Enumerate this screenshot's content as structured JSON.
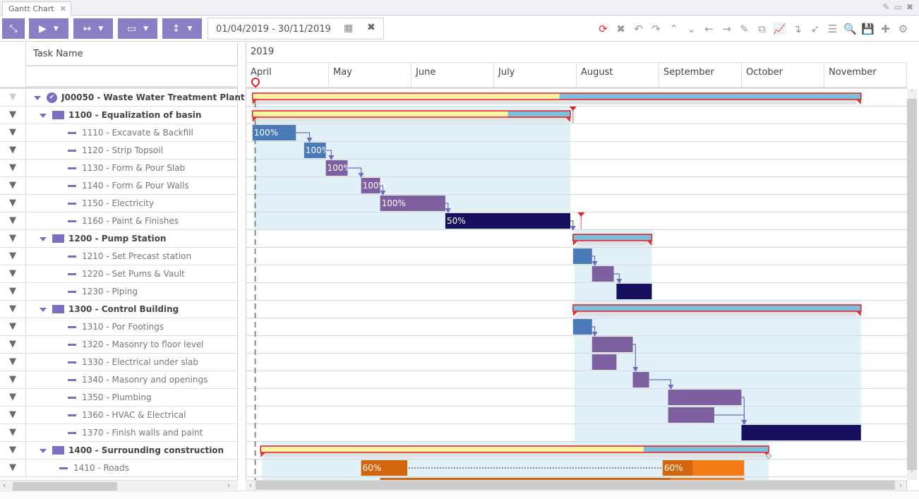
{
  "window": {
    "tab_label": "Gantt Chart",
    "tab_close_icon": "close-icon",
    "window_icons": [
      "edit-icon",
      "maximize-icon",
      "close-icon"
    ]
  },
  "toolbar": {
    "left_buttons": [
      {
        "name": "collapse-button",
        "icon": "compress-icon",
        "glyph": "⤡",
        "dropdown": false
      },
      {
        "name": "play-button",
        "icon": "play-icon",
        "glyph": "▶",
        "dropdown": true
      },
      {
        "name": "fit-width-button",
        "icon": "horizontal-arrows-icon",
        "glyph": "↔",
        "dropdown": true
      },
      {
        "name": "display-button",
        "icon": "monitor-icon",
        "glyph": "🖵",
        "dropdown": true
      },
      {
        "name": "row-height-button",
        "icon": "vertical-arrows-icon",
        "glyph": "↕",
        "dropdown": true
      }
    ],
    "date_range": "01/04/2019 - 30/11/2019",
    "right_icons": [
      {
        "name": "refresh-icon",
        "glyph": "⟳",
        "accent": true
      },
      {
        "name": "cancel-icon",
        "glyph": "✖"
      },
      {
        "name": "undo-icon",
        "glyph": "↶"
      },
      {
        "name": "redo-icon",
        "glyph": "↷"
      },
      {
        "name": "collapse-all-icon",
        "glyph": "⌃"
      },
      {
        "name": "expand-all-icon",
        "glyph": "⌄"
      },
      {
        "name": "arrow-left-icon",
        "glyph": "←"
      },
      {
        "name": "arrow-right-icon",
        "glyph": "→"
      },
      {
        "name": "highlight-icon",
        "glyph": "✎"
      },
      {
        "name": "fit-to-screen-icon",
        "glyph": "⧉"
      },
      {
        "name": "line-chart-icon",
        "glyph": "📈"
      },
      {
        "name": "indent-icon",
        "glyph": "↴"
      },
      {
        "name": "rocket-icon",
        "glyph": "➶"
      },
      {
        "name": "list-icon",
        "glyph": "☰"
      },
      {
        "name": "search-icon",
        "glyph": "🔍"
      },
      {
        "name": "save-icon",
        "glyph": "💾"
      },
      {
        "name": "add-icon",
        "glyph": "✚"
      },
      {
        "name": "settings-icon",
        "glyph": "⚙"
      }
    ]
  },
  "grid": {
    "column_header": "Task Name",
    "rows": [
      {
        "label": "J00050 - Waste Water Treatment Plant",
        "level": 0,
        "type": "project"
      },
      {
        "label": "1100 - Equalization of basin",
        "level": 1,
        "type": "group"
      },
      {
        "label": "1110 - Excavate & Backfill",
        "level": 2,
        "type": "task"
      },
      {
        "label": "1120 - Strip Topsoil",
        "level": 2,
        "type": "task"
      },
      {
        "label": "1130 - Form & Pour Slab",
        "level": 2,
        "type": "task"
      },
      {
        "label": "1140 - Form & Pour Walls",
        "level": 2,
        "type": "task"
      },
      {
        "label": "1150 - Electricity",
        "level": 2,
        "type": "task"
      },
      {
        "label": "1160 - Paint & Finishes",
        "level": 2,
        "type": "task"
      },
      {
        "label": "1200 - Pump Station",
        "level": 1,
        "type": "group"
      },
      {
        "label": "1210 - Set Precast station",
        "level": 2,
        "type": "task"
      },
      {
        "label": "1220 - Set Pums & Vault",
        "level": 2,
        "type": "task"
      },
      {
        "label": "1230 - Piping",
        "level": 2,
        "type": "task"
      },
      {
        "label": "1300 - Control Building",
        "level": 1,
        "type": "group"
      },
      {
        "label": "1310 - Por Footings",
        "level": 2,
        "type": "task"
      },
      {
        "label": "1320 - Masonry to floor level",
        "level": 2,
        "type": "task"
      },
      {
        "label": "1330 - Electrical under slab",
        "level": 2,
        "type": "task"
      },
      {
        "label": "1340 - Masonry and openings",
        "level": 2,
        "type": "task"
      },
      {
        "label": "1350 - Plumbing",
        "level": 2,
        "type": "task"
      },
      {
        "label": "1360 - HVAC & Electrical",
        "level": 2,
        "type": "task"
      },
      {
        "label": "1370 - Finish walls and paint",
        "level": 2,
        "type": "task"
      },
      {
        "label": "1400 - Surrounding construction",
        "level": 1,
        "type": "group"
      },
      {
        "label": "1410 - Roads",
        "level": 1.5,
        "type": "task"
      }
    ]
  },
  "timeline": {
    "year": "2019",
    "months": [
      "April",
      "May",
      "June",
      "July",
      "August",
      "September",
      "October",
      "November"
    ],
    "unit": "days since 2019-04-01",
    "colors": {
      "summary_progress": "#fff3a6",
      "summary_remaining": "#7cbfdc",
      "summary_border": "#e41e1e",
      "task_blue": "#4a7ab8",
      "task_purple": "#7e60a0",
      "task_navy": "#16105f",
      "task_orange": "#d2660f",
      "task_orange_light": "#f37c16",
      "group_bg": "#e2f1f7",
      "link": "#6d6bbf"
    },
    "bars": [
      {
        "row": 0,
        "kind": "summary",
        "start": 2,
        "end": 226,
        "progress_end": 115
      },
      {
        "row": 1,
        "kind": "summary",
        "start": 2,
        "end": 119,
        "progress_end": 96
      },
      {
        "row": 2,
        "kind": "task",
        "start": 2,
        "end": 18,
        "color": "task_blue",
        "label": "100%"
      },
      {
        "row": 3,
        "kind": "task",
        "start": 21,
        "end": 29,
        "color": "task_blue",
        "label": "100%"
      },
      {
        "row": 4,
        "kind": "task",
        "start": 29,
        "end": 37,
        "color": "task_purple",
        "label": "100%"
      },
      {
        "row": 5,
        "kind": "task",
        "start": 42,
        "end": 49,
        "color": "task_purple",
        "label": "100%"
      },
      {
        "row": 6,
        "kind": "task",
        "start": 49,
        "end": 73,
        "color": "task_purple",
        "label": "100%"
      },
      {
        "row": 7,
        "kind": "task",
        "start": 73,
        "end": 119,
        "color": "task_navy",
        "label": "50%"
      },
      {
        "row": 8,
        "kind": "summary",
        "start": 120,
        "end": 149,
        "progress_end": 120
      },
      {
        "row": 9,
        "kind": "task",
        "start": 120,
        "end": 127,
        "color": "task_blue",
        "label": ""
      },
      {
        "row": 10,
        "kind": "task",
        "start": 127,
        "end": 135,
        "color": "task_purple",
        "label": ""
      },
      {
        "row": 11,
        "kind": "task",
        "start": 136,
        "end": 149,
        "color": "task_navy",
        "label": ""
      },
      {
        "row": 12,
        "kind": "summary",
        "start": 120,
        "end": 226,
        "progress_end": 120
      },
      {
        "row": 13,
        "kind": "task",
        "start": 120,
        "end": 127,
        "color": "task_blue",
        "label": ""
      },
      {
        "row": 14,
        "kind": "task",
        "start": 127,
        "end": 142,
        "color": "task_purple",
        "label": ""
      },
      {
        "row": 15,
        "kind": "task",
        "start": 127,
        "end": 136,
        "color": "task_purple",
        "label": ""
      },
      {
        "row": 16,
        "kind": "task",
        "start": 142,
        "end": 148,
        "color": "task_purple",
        "label": ""
      },
      {
        "row": 17,
        "kind": "task",
        "start": 155,
        "end": 182,
        "color": "task_purple",
        "label": ""
      },
      {
        "row": 18,
        "kind": "task",
        "start": 155,
        "end": 172,
        "color": "task_purple",
        "label": ""
      },
      {
        "row": 19,
        "kind": "task",
        "start": 182,
        "end": 226,
        "color": "task_navy",
        "label": ""
      },
      {
        "row": 20,
        "kind": "summary",
        "start": 5,
        "end": 192,
        "progress_end": 146
      },
      {
        "row": 21,
        "kind": "task",
        "start": 42,
        "end": 59,
        "color": "task_orange",
        "label": "60%"
      },
      {
        "row": 21,
        "kind": "task",
        "start": 153,
        "end": 183,
        "color": "task_orange_light",
        "progress_end": 164,
        "label": "60%"
      }
    ],
    "group_areas": [
      {
        "from_row": 1,
        "to_row": 7,
        "start": 2,
        "end": 119
      },
      {
        "from_row": 8,
        "to_row": 11,
        "start": 120,
        "end": 149
      },
      {
        "from_row": 12,
        "to_row": 19,
        "start": 120,
        "end": 226
      },
      {
        "from_row": 20,
        "to_row": 22,
        "start": 5,
        "end": 192
      }
    ],
    "links": [
      {
        "from_row": 2,
        "from_day": 18,
        "to_row": 3,
        "to_day": 23
      },
      {
        "from_row": 3,
        "from_day": 29,
        "to_row": 4,
        "to_day": 31
      },
      {
        "from_row": 4,
        "from_day": 37,
        "to_row": 5,
        "to_day": 42
      },
      {
        "from_row": 5,
        "from_day": 49,
        "to_row": 6,
        "to_day": 50
      },
      {
        "from_row": 6,
        "from_day": 73,
        "to_row": 7,
        "to_day": 74
      },
      {
        "from_row": 7,
        "from_day": 119,
        "to_row": 8,
        "to_day": 120
      },
      {
        "from_row": 9,
        "from_day": 127,
        "to_row": 10,
        "to_day": 128
      },
      {
        "from_row": 10,
        "from_day": 135,
        "to_row": 11,
        "to_day": 137
      },
      {
        "from_row": 13,
        "from_day": 127,
        "to_row": 14,
        "to_day": 128
      },
      {
        "from_row": 14,
        "from_day": 142,
        "to_row": 16,
        "to_day": 143
      },
      {
        "from_row": 16,
        "from_day": 148,
        "to_row": 17,
        "to_day": 156
      },
      {
        "from_row": 17,
        "from_day": 182,
        "to_row": 19,
        "to_day": 183
      },
      {
        "from_row": 18,
        "from_day": 172,
        "to_row": 19,
        "to_day": 183
      }
    ],
    "deadlines": [
      {
        "row": 1,
        "day": 120
      },
      {
        "row": 7,
        "day": 123
      }
    ],
    "today_day": 3
  }
}
